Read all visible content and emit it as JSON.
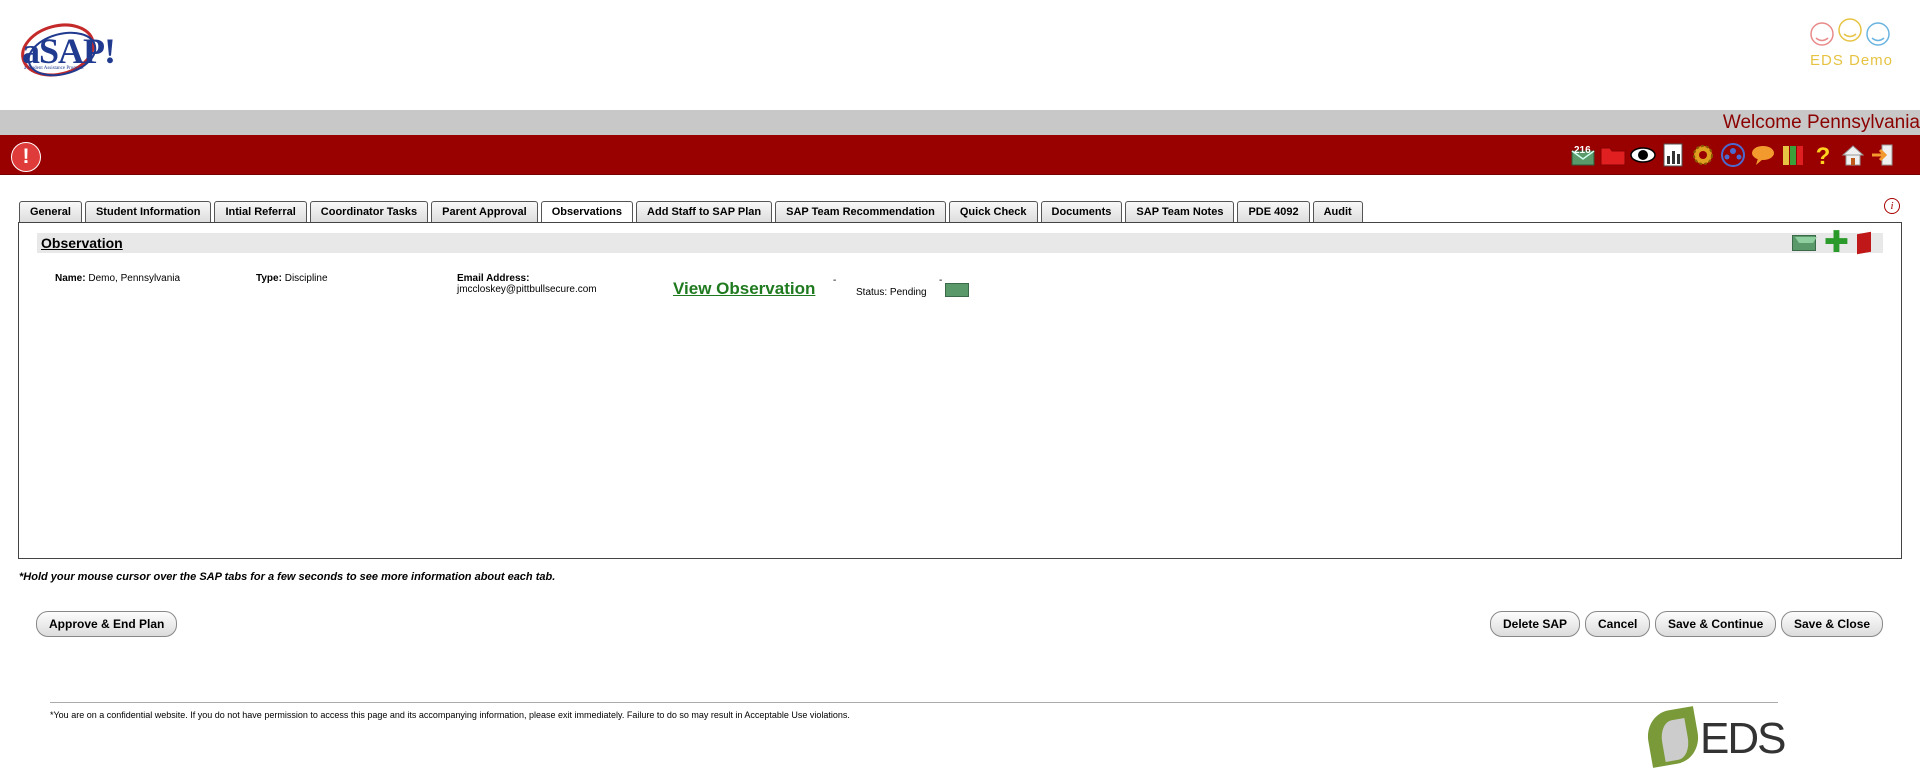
{
  "header": {
    "logo_text": "aSAP!",
    "logo_subtitle": "a Student Assistance Program",
    "demo_logo_text": "EDS Demo",
    "welcome": "Welcome Pennsylvania"
  },
  "toolbar": {
    "notification_count": "216",
    "icons": [
      "mail-icon",
      "folder-icon",
      "eye-icon",
      "report-icon",
      "settings-icon",
      "people-icon",
      "chat-icon",
      "books-icon",
      "help-icon",
      "home-icon",
      "logout-icon"
    ]
  },
  "tabs": [
    {
      "label": "General"
    },
    {
      "label": "Student Information"
    },
    {
      "label": "Intial Referral"
    },
    {
      "label": "Coordinator Tasks"
    },
    {
      "label": "Parent Approval"
    },
    {
      "label": "Observations",
      "active": true
    },
    {
      "label": "Add Staff to SAP Plan"
    },
    {
      "label": "SAP Team Recommendation"
    },
    {
      "label": "Quick Check"
    },
    {
      "label": "Documents"
    },
    {
      "label": "SAP Team Notes"
    },
    {
      "label": "PDE 4092"
    },
    {
      "label": "Audit"
    }
  ],
  "observation": {
    "section_title": "Observation",
    "name_label": "Name:",
    "name_value": "Demo, Pennsylvania",
    "type_label": "Type:",
    "type_value": "Discipline",
    "email_label": "Email Address:",
    "email_value": "jmccloskey@pittbullsecure.com",
    "view_link": "View Observation",
    "dash": "-",
    "status_label": "Status:",
    "status_value": "Pending"
  },
  "hint": "*Hold your mouse cursor over the SAP tabs for a few seconds to see more information about each tab.",
  "buttons": {
    "approve": "Approve & End Plan",
    "delete": "Delete SAP",
    "cancel": "Cancel",
    "save_continue": "Save & Continue",
    "save_close": "Save & Close"
  },
  "footer": {
    "notice": "*You are on a confidential website. If you do not have permission to access this page and its accompanying information, please exit immediately. Failure to do so may result in Acceptable Use violations.",
    "logo_text": "EDS"
  },
  "colors": {
    "brand_red": "#990000",
    "link_green": "#1f7a1f"
  }
}
